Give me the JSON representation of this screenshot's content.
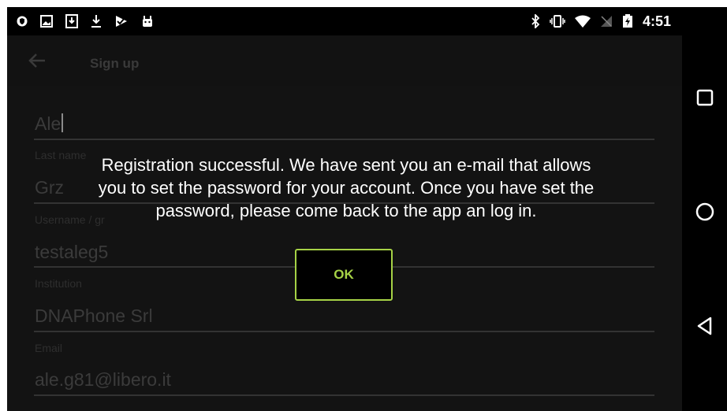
{
  "status_bar": {
    "time": "4:51",
    "left_icons": [
      "shield-icon",
      "image-icon",
      "download-box-icon",
      "download-icon",
      "check-flag-icon",
      "android-icon"
    ],
    "right_icons": [
      "bluetooth-icon",
      "vibrate-icon",
      "wifi-icon",
      "no-signal-icon",
      "battery-charging-icon"
    ]
  },
  "toolbar": {
    "title": "Sign up"
  },
  "form": {
    "first_name_value": "Ale",
    "last_name_label": "Last name",
    "last_name_value": "Grz",
    "username_label": "Username / gr",
    "username_value": "testaleg5",
    "institution_label": "Institution",
    "institution_value": "DNAPhone Srl",
    "email_label": "Email",
    "email_value": "ale.g81@libero.it"
  },
  "dialog": {
    "message_line1": "Registration successful. We have sent you an e-mail that allows",
    "message_line2": "you to set the password for your account. Once you have set the",
    "message_line3": "password, please come back to the app an log in.",
    "ok_label": "OK"
  },
  "colors": {
    "accent": "#a6d246",
    "background": "#000000",
    "dimmed_text": "#3b3b3b"
  },
  "nav_bar": {
    "icons": [
      "recents-square-icon",
      "home-circle-icon",
      "back-triangle-icon"
    ]
  }
}
